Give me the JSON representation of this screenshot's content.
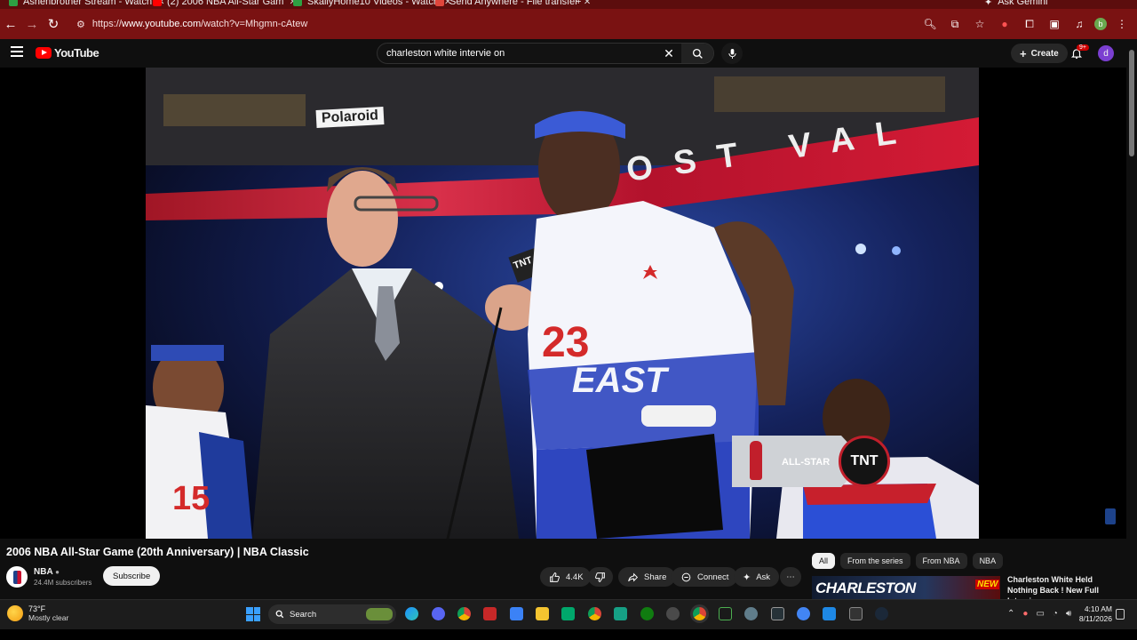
{
  "browser": {
    "tabs": [
      {
        "label": "Ashenbrother Stream - Watch",
        "color": "#2ea043"
      },
      {
        "label": "(2) 2006 NBA All-Star Gam",
        "color": "#ff0000"
      },
      {
        "label": "SkallyHome10 Videos - Watch",
        "color": "#2ea043"
      },
      {
        "label": "Send Anywhere - File transfer",
        "color": "#e0463c"
      }
    ],
    "gemini_label": "Ask Gemini",
    "url_prefix": "https://",
    "url_domain": "www.youtube.com",
    "url_path": "/watch?v=Mhgmn-cAtew",
    "profile_letter": "b"
  },
  "youtube": {
    "logo_text": "YouTube",
    "search_value": "charleston white intervie on",
    "create_label": "Create",
    "notifications_badge": "9+",
    "avatar_letter": "d"
  },
  "video": {
    "title": "2006 NBA All-Star Game (20th Anniversary) | NBA Classic",
    "scoreboard_text": "OST VAL",
    "sponsor_text": "Polaroid",
    "mic_flag": "TNT",
    "bug_allstar": "ALL-STAR",
    "bug_network": "TNT",
    "jersey_number_main": "23",
    "jersey_text_main": "EAST",
    "jersey_number_left": "15"
  },
  "channel": {
    "name": "NBA",
    "subscribers": "24.4M subscribers",
    "subscribe_label": "Subscribe"
  },
  "actions": {
    "likes": "4.4K",
    "share": "Share",
    "connect": "Connect",
    "ask": "Ask"
  },
  "chips": [
    "All",
    "From the series",
    "From NBA",
    "NBA"
  ],
  "recommendation": {
    "thumb_text": "CHARLESTON",
    "thumb_badge": "NEW",
    "title": "Charleston White Held Nothing Back ! New Full Interview"
  },
  "taskbar": {
    "temperature": "73°F",
    "weather": "Mostly clear",
    "search_label": "Search",
    "time": "4:10 AM",
    "date": "8/11/2026"
  }
}
